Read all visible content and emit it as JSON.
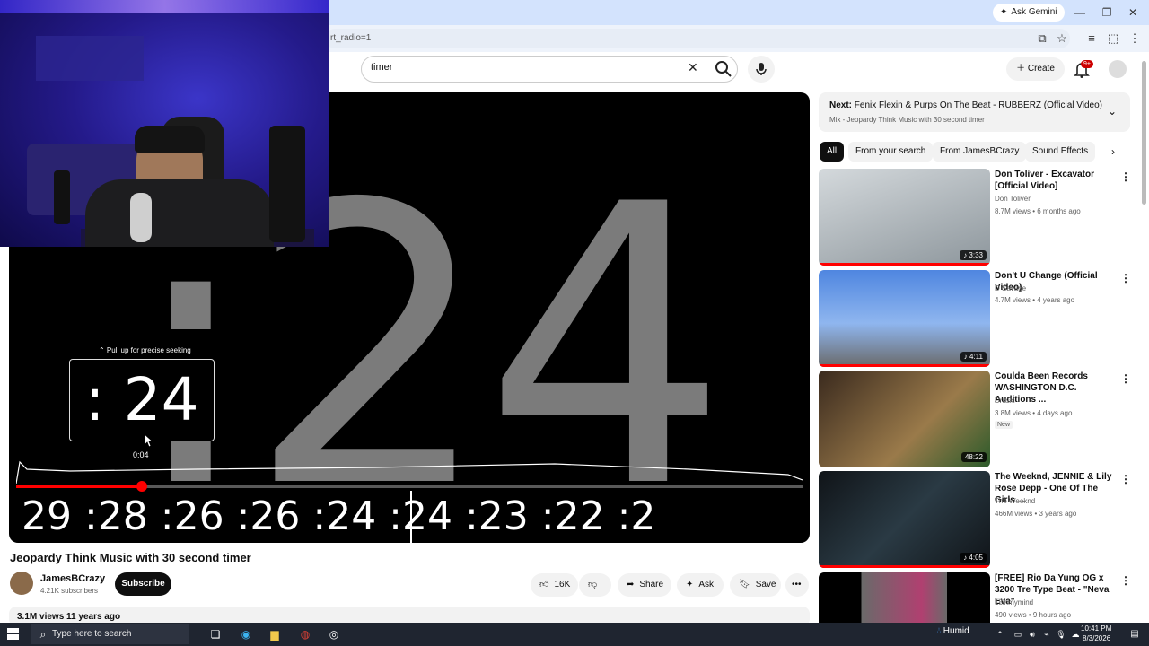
{
  "browser": {
    "ask_gemini": "Ask Gemini",
    "url_fragment": "rt_radio=1"
  },
  "header": {
    "search_value": "timer",
    "create_label": "Create",
    "notification_badge": "9+"
  },
  "player": {
    "big_timer": ":24",
    "seek_hint": "⌃ Pull up for precise seeking",
    "seek_preview": ": 24",
    "seek_time": "0:04",
    "progress_fraction": 0.16,
    "storyboard": "29 :28 :26 :26 :24 :24 :23 :22 :2"
  },
  "video": {
    "title": "Jeopardy Think Music with 30 second timer",
    "channel": "JamesBCrazy",
    "subscribers": "4.21K subscribers",
    "subscribe_label": "Subscribe",
    "likes": "16K",
    "share_label": "Share",
    "ask_label": "Ask",
    "save_label": "Save",
    "views_date": "3.1M views  11 years ago"
  },
  "sidebar": {
    "next_prefix": "Next:",
    "next_title": "Fenix Flexin & Purps On The Beat - RUBBERZ (Official Video)",
    "next_sub": "Mix - Jeopardy Think Music with 30 second timer",
    "chips": [
      "All",
      "From your search",
      "From JamesBCrazy",
      "Sound Effects"
    ],
    "recommendations": [
      {
        "title": "Don Toliver - Excavator [Official Video]",
        "channel": "Don Toliver",
        "meta": "8.7M views • 6 months ago",
        "duration": "♪ 3:33",
        "thumb_color": "#b7c0c6"
      },
      {
        "title": "Don't U Change (Official Video)",
        "channel": "D Savage",
        "meta": "4.7M views • 4 years ago",
        "duration": "♪ 4:11",
        "thumb_color": "#5f8fd8"
      },
      {
        "title": "Coulda Been Records WASHINGTON D.C. Auditions ...",
        "channel": "Druski",
        "meta": "3.8M views • 4 days ago",
        "badge": "New",
        "duration": "48:22",
        "thumb_color": "#7a5a3a"
      },
      {
        "title": "The Weeknd, JENNIE & Lily Rose Depp - One Of The Girls ...",
        "channel": "The Weeknd",
        "meta": "466M views • 3 years ago",
        "duration": "♪ 4:05",
        "thumb_color": "#1e2a30"
      },
      {
        "title": "[FREE] Rio Da Yung OG x 3200 Tre Type Beat - \"Neva Eva\"",
        "channel": "18inmymind",
        "meta": "490 views • 9 hours ago",
        "duration": "",
        "thumb_color": "#4a4a4a"
      }
    ]
  },
  "taskbar": {
    "search_placeholder": "Type here to search",
    "weather": "Humid",
    "time": "10:41 PM",
    "date": "8/3/2026"
  }
}
